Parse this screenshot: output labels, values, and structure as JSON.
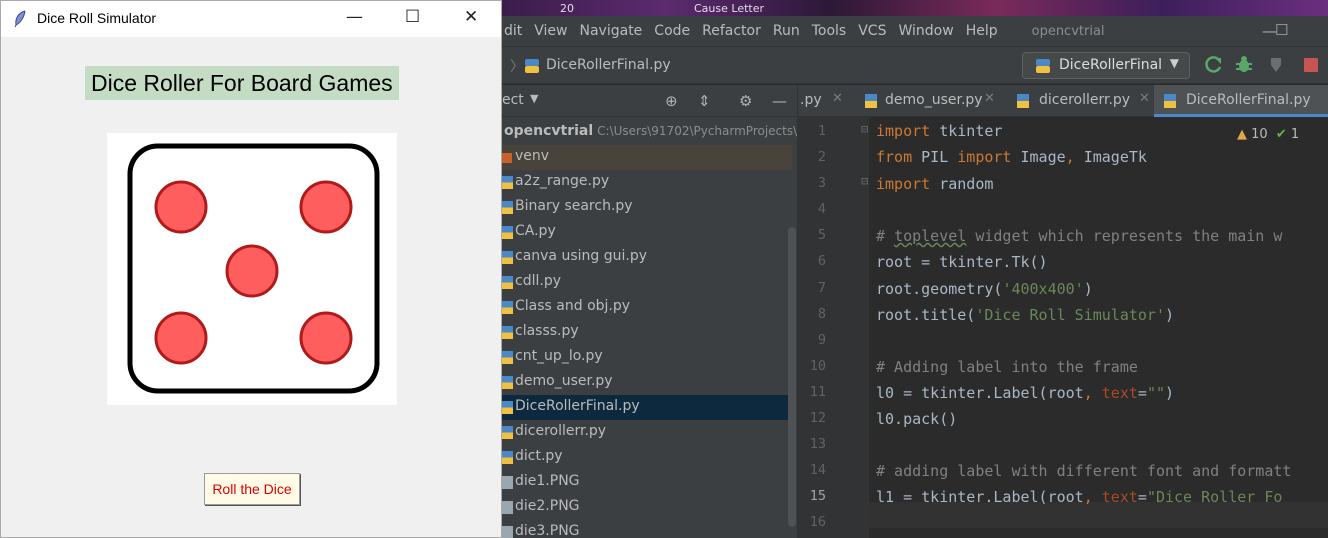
{
  "wallpaper": {
    "left_text": "20",
    "right_text": "Cause Letter"
  },
  "ide": {
    "menu": [
      "dit",
      "View",
      "Navigate",
      "Code",
      "Refactor",
      "Run",
      "Tools",
      "VCS",
      "Window",
      "Help"
    ],
    "project_title": "opencvtrial",
    "nav_file": "DiceRollerFinal.py",
    "run_config": "DiceRollerFinal",
    "project_panel_label": "ect",
    "tree": {
      "root_name": "opencvtrial",
      "root_path": "C:\\Users\\91702\\PycharmProjects\\",
      "items": [
        "venv",
        "a2z_range.py",
        "Binary search.py",
        "CA.py",
        "canva using gui.py",
        "cdll.py",
        "Class and obj.py",
        "classs.py",
        "cnt_up_lo.py",
        "demo_user.py",
        "DiceRollerFinal.py",
        "dicerollerr.py",
        "dict.py",
        "die1.PNG",
        "die2.PNG",
        "die3.PNG"
      ]
    },
    "tabs": [
      ".py",
      "demo_user.py",
      "dicerollerr.py",
      "DiceRollerFinal.py"
    ],
    "inspection": {
      "warnings": "10",
      "ok": "1"
    },
    "line_numbers": [
      "1",
      "2",
      "3",
      "4",
      "5",
      "6",
      "7",
      "8",
      "9",
      "10",
      "11",
      "12",
      "13",
      "14",
      "15",
      "16"
    ],
    "code": {
      "l1_kw": "import",
      "l1_rest": " tkinter",
      "l2_kw1": "from",
      "l2_mid": " PIL ",
      "l2_kw2": "import",
      "l2_rest": " Image",
      "l2_comma": ",",
      "l2_end": " ImageTk",
      "l3_kw": "import",
      "l3_rest": " random",
      "l5_a": "# ",
      "l5_b": "toplevel",
      "l5_c": " widget which represents the main w",
      "l6": "root = tkinter.Tk()",
      "l7_a": "root.geometry(",
      "l7_b": "'400x400'",
      "l7_c": ")",
      "l8_a": "root.title(",
      "l8_b": "'Dice Roll Simulator'",
      "l8_c": ")",
      "l10": "# Adding label into the frame",
      "l11_a": "l0 = tkinter.Label(root",
      "l11_b": ",",
      "l11_c": " text",
      "l11_d": "=",
      "l11_e": "\"\"",
      "l11_f": ")",
      "l12": "l0.pack()",
      "l14": "# adding label with different font and formatt",
      "l15_a": "l1 = tkinter.Label(root",
      "l15_b": ",",
      "l15_c": " text",
      "l15_d": "=",
      "l15_e": "\"Dice Roller Fo"
    }
  },
  "tk": {
    "title": "Dice Roll Simulator",
    "heading": "Dice Roller For Board Games",
    "button_label": "Roll the Dice",
    "die_value": 5
  }
}
